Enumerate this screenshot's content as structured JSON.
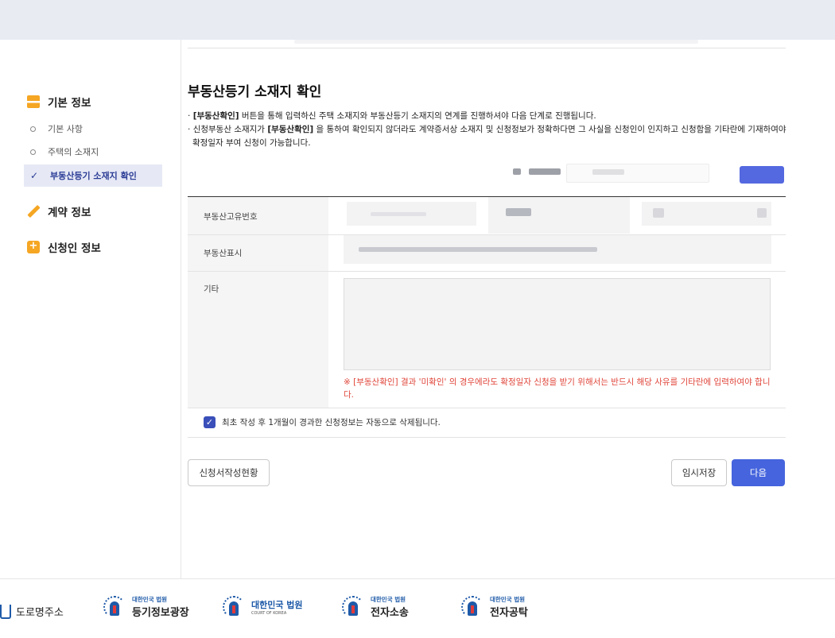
{
  "sidebar": {
    "sections": [
      {
        "label": "기본 정보",
        "icon": "basic-info-icon"
      },
      {
        "label": "계약 정보",
        "icon": "pencil-icon"
      },
      {
        "label": "신청인 정보",
        "icon": "plus-box-icon"
      }
    ],
    "subitems": [
      {
        "label": "기본 사항",
        "active": false
      },
      {
        "label": "주택의 소재지",
        "active": false
      },
      {
        "label": "부동산등기 소재지 확인",
        "active": true
      }
    ]
  },
  "main": {
    "title": "부동산등기 소재지 확인",
    "notes": {
      "n1_bold": "[부동산확인]",
      "n1_rest": " 버튼을 통해 입력하신 주택 소재지와 부동산등기 소재지의 연계를 진행하셔야 다음 단계로 진행됩니다.",
      "n2_pre": "신청부동산 소재지가 ",
      "n2_bold": "[부동산확인]",
      "n2_rest": " 을 통하여 확인되지 않더라도 계약증서상 소재지 및 신청정보가 정확하다면 그 사실을 신청인이 인지하고 신청함을 기타란에 기재하여야 확정일자 부여 신청이 가능합니다."
    },
    "form": {
      "unique_no_label": "부동산고유번호",
      "display_label": "부동산표시",
      "etc_label": "기타",
      "etc_warning": "※ [부동산확인] 결과 '미확인' 의 경우에라도 확정일자 신청을 받기 위해서는 반드시 해당 사유를 기타란에 입력하여야 합니다."
    },
    "auto_delete": {
      "checked": true,
      "label": "최초 작성 후 1개월이 경과한 신청정보는 자동으로 삭제됩니다."
    },
    "buttons": {
      "status": "신청서작성현황",
      "temp_save": "임시저장",
      "next": "다음"
    }
  },
  "footer": {
    "road_address": "도로명주소",
    "registry": {
      "small": "대한민국 법원",
      "big": "등기정보광장"
    },
    "court": {
      "small": "대한민국 법원",
      "tiny": "COURT OF KOREA"
    },
    "ecourt": {
      "small": "대한민국 법원",
      "big": "전자소송"
    },
    "deposit": {
      "small": "대한민국 법원",
      "big": "전자공탁"
    }
  },
  "colors": {
    "accent": "#4564dd",
    "sidebar_active_bg": "#e6e9f5",
    "warning": "#e0453a",
    "icon_orange": "#f5a623"
  }
}
